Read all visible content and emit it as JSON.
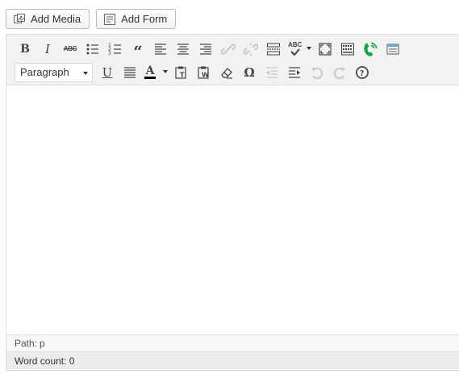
{
  "media_buttons": {
    "add_media": {
      "label": "Add Media",
      "icon": "media-icon"
    },
    "add_form": {
      "label": "Add Form",
      "icon": "form-icon"
    }
  },
  "toolbar": {
    "row1": [
      "bold",
      "italic",
      "strikethrough",
      "bulleted-list",
      "numbered-list",
      "blockquote",
      "align-left",
      "align-center",
      "align-right",
      "insert-link (disabled)",
      "remove-link (disabled)",
      "insert-more",
      "spellcheck",
      "fullscreen",
      "toolbar-toggle",
      "phone-plugin",
      "media-plugin"
    ],
    "row2": [
      "format-select",
      "underline",
      "justify",
      "text-color",
      "paste-as-text",
      "paste-from-word",
      "clear-formatting",
      "special-character",
      "outdent (disabled)",
      "indent",
      "undo (disabled)",
      "redo (disabled)",
      "help"
    ],
    "format_select": {
      "selected": "Paragraph"
    },
    "spellcheck_label": "ABC",
    "strikethrough_label": "ABC",
    "text_color_letter": "A",
    "text_color": "#000000",
    "special_char_label": "Ω",
    "colors": {
      "toolbar_bg": "#f2f2f2",
      "icon": "#444444",
      "disabled_icon": "#c3c3c3",
      "phone_icon": "#16a34a"
    }
  },
  "editor": {
    "content": ""
  },
  "status": {
    "path_label": "Path:",
    "path_value": "p",
    "word_count": "Word count: 0"
  }
}
